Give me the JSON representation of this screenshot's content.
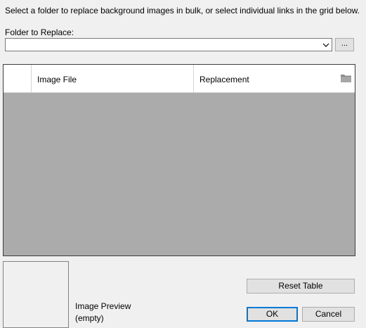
{
  "dialog": {
    "instruction": "Select a folder to replace background images in bulk, or select individual links in the grid below.",
    "folder_label": "Folder to Replace:",
    "folder_value": "",
    "browse_label": "..."
  },
  "grid": {
    "columns": [
      "",
      "Image File",
      "Replacement"
    ],
    "rows": [],
    "header_bg": "#ffffff",
    "empty_bg": "#ababab"
  },
  "preview": {
    "label": "Image Preview",
    "status": "(empty)"
  },
  "buttons": {
    "reset": "Reset Table",
    "ok": "OK",
    "cancel": "Cancel"
  },
  "icons": {
    "combo_arrow": "chevron-down-icon",
    "replacement_column": "folder-icon"
  },
  "colors": {
    "window_bg": "#f0f0f0",
    "focus_accent": "#0078d7"
  }
}
